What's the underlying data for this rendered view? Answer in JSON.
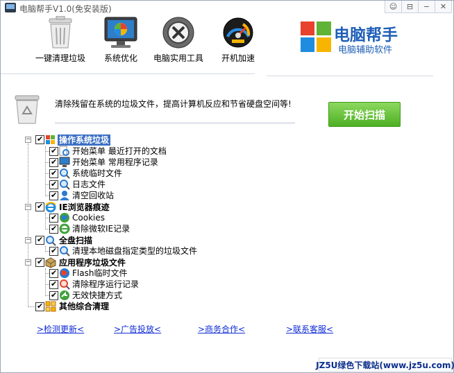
{
  "window": {
    "title": "电脑帮手V1.0(免安装版)",
    "controls": [
      "feedback-icon",
      "skin-icon",
      "minimize-icon",
      "close-icon"
    ]
  },
  "toolbar": {
    "items": [
      {
        "label": "一键清理垃圾",
        "icon": "trash-bin-icon"
      },
      {
        "label": "系统优化",
        "icon": "monitor-icon"
      },
      {
        "label": "电脑实用工具",
        "icon": "tools-icon"
      },
      {
        "label": "开机加速",
        "icon": "speedometer-icon"
      }
    ]
  },
  "brand": {
    "title": "电脑帮手",
    "subtitle": "电脑辅助软件",
    "colors": [
      "#e8412c",
      "#5fb336",
      "#1f8ce0",
      "#f7b500"
    ]
  },
  "info": {
    "text": "清除残留在系统的垃圾文件，提高计算机反应和节省硬盘空间等!",
    "scan_button": "开始扫描"
  },
  "tree": {
    "groups": [
      {
        "label": "操作系统垃圾",
        "icon": "windows-icon",
        "selected": true,
        "children": [
          {
            "label": "开始菜单  最近打开的文档",
            "icon": "search-doc-icon"
          },
          {
            "label": "开始菜单  常用程序记录",
            "icon": "computer-icon"
          },
          {
            "label": "系统临时文件",
            "icon": "magnifier-icon"
          },
          {
            "label": "日志文件",
            "icon": "magnifier-icon"
          },
          {
            "label": "清空回收站",
            "icon": "user-icon"
          }
        ]
      },
      {
        "label": "IE浏览器痕迹",
        "icon": "ie-icon",
        "selected": false,
        "children": [
          {
            "label": "Cookies",
            "icon": "globe-icon"
          },
          {
            "label": "清除微软IE记录",
            "icon": "ie-icon"
          }
        ]
      },
      {
        "label": "全盘扫描",
        "icon": "magnifier-icon",
        "selected": false,
        "children": [
          {
            "label": "清理本地磁盘指定类型的垃圾文件",
            "icon": "magnifier-icon"
          }
        ]
      },
      {
        "label": "应用程序垃圾文件",
        "icon": "package-icon",
        "selected": false,
        "children": [
          {
            "label": "Flash临时文件",
            "icon": "globe-icon"
          },
          {
            "label": "清除程序运行记录",
            "icon": "magnifier-icon"
          },
          {
            "label": "无效快捷方式",
            "icon": "shortcut-icon"
          }
        ]
      },
      {
        "label": "其他综合清理",
        "icon": "grid-icon",
        "selected": false,
        "children": []
      }
    ]
  },
  "links": [
    {
      "label": ">检测更新<"
    },
    {
      "label": ">广告投放<"
    },
    {
      "label": ">商务合作<"
    },
    {
      "label": ">联系客服<"
    }
  ],
  "footer": {
    "badge": "JZ5U绿色下载站(www.jz5u.com)"
  }
}
